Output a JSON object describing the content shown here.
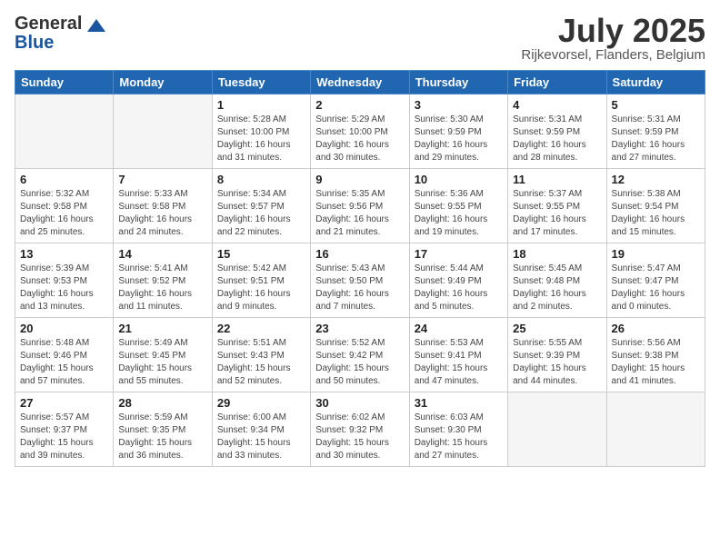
{
  "header": {
    "logo_general": "General",
    "logo_blue": "Blue",
    "month_year": "July 2025",
    "location": "Rijkevorsel, Flanders, Belgium"
  },
  "days_of_week": [
    "Sunday",
    "Monday",
    "Tuesday",
    "Wednesday",
    "Thursday",
    "Friday",
    "Saturday"
  ],
  "weeks": [
    [
      {
        "day": "",
        "empty": true
      },
      {
        "day": "",
        "empty": true
      },
      {
        "day": "1",
        "sunrise": "5:28 AM",
        "sunset": "10:00 PM",
        "daylight": "16 hours and 31 minutes."
      },
      {
        "day": "2",
        "sunrise": "5:29 AM",
        "sunset": "10:00 PM",
        "daylight": "16 hours and 30 minutes."
      },
      {
        "day": "3",
        "sunrise": "5:30 AM",
        "sunset": "9:59 PM",
        "daylight": "16 hours and 29 minutes."
      },
      {
        "day": "4",
        "sunrise": "5:31 AM",
        "sunset": "9:59 PM",
        "daylight": "16 hours and 28 minutes."
      },
      {
        "day": "5",
        "sunrise": "5:31 AM",
        "sunset": "9:59 PM",
        "daylight": "16 hours and 27 minutes."
      }
    ],
    [
      {
        "day": "6",
        "sunrise": "5:32 AM",
        "sunset": "9:58 PM",
        "daylight": "16 hours and 25 minutes."
      },
      {
        "day": "7",
        "sunrise": "5:33 AM",
        "sunset": "9:58 PM",
        "daylight": "16 hours and 24 minutes."
      },
      {
        "day": "8",
        "sunrise": "5:34 AM",
        "sunset": "9:57 PM",
        "daylight": "16 hours and 22 minutes."
      },
      {
        "day": "9",
        "sunrise": "5:35 AM",
        "sunset": "9:56 PM",
        "daylight": "16 hours and 21 minutes."
      },
      {
        "day": "10",
        "sunrise": "5:36 AM",
        "sunset": "9:55 PM",
        "daylight": "16 hours and 19 minutes."
      },
      {
        "day": "11",
        "sunrise": "5:37 AM",
        "sunset": "9:55 PM",
        "daylight": "16 hours and 17 minutes."
      },
      {
        "day": "12",
        "sunrise": "5:38 AM",
        "sunset": "9:54 PM",
        "daylight": "16 hours and 15 minutes."
      }
    ],
    [
      {
        "day": "13",
        "sunrise": "5:39 AM",
        "sunset": "9:53 PM",
        "daylight": "16 hours and 13 minutes."
      },
      {
        "day": "14",
        "sunrise": "5:41 AM",
        "sunset": "9:52 PM",
        "daylight": "16 hours and 11 minutes."
      },
      {
        "day": "15",
        "sunrise": "5:42 AM",
        "sunset": "9:51 PM",
        "daylight": "16 hours and 9 minutes."
      },
      {
        "day": "16",
        "sunrise": "5:43 AM",
        "sunset": "9:50 PM",
        "daylight": "16 hours and 7 minutes."
      },
      {
        "day": "17",
        "sunrise": "5:44 AM",
        "sunset": "9:49 PM",
        "daylight": "16 hours and 5 minutes."
      },
      {
        "day": "18",
        "sunrise": "5:45 AM",
        "sunset": "9:48 PM",
        "daylight": "16 hours and 2 minutes."
      },
      {
        "day": "19",
        "sunrise": "5:47 AM",
        "sunset": "9:47 PM",
        "daylight": "16 hours and 0 minutes."
      }
    ],
    [
      {
        "day": "20",
        "sunrise": "5:48 AM",
        "sunset": "9:46 PM",
        "daylight": "15 hours and 57 minutes."
      },
      {
        "day": "21",
        "sunrise": "5:49 AM",
        "sunset": "9:45 PM",
        "daylight": "15 hours and 55 minutes."
      },
      {
        "day": "22",
        "sunrise": "5:51 AM",
        "sunset": "9:43 PM",
        "daylight": "15 hours and 52 minutes."
      },
      {
        "day": "23",
        "sunrise": "5:52 AM",
        "sunset": "9:42 PM",
        "daylight": "15 hours and 50 minutes."
      },
      {
        "day": "24",
        "sunrise": "5:53 AM",
        "sunset": "9:41 PM",
        "daylight": "15 hours and 47 minutes."
      },
      {
        "day": "25",
        "sunrise": "5:55 AM",
        "sunset": "9:39 PM",
        "daylight": "15 hours and 44 minutes."
      },
      {
        "day": "26",
        "sunrise": "5:56 AM",
        "sunset": "9:38 PM",
        "daylight": "15 hours and 41 minutes."
      }
    ],
    [
      {
        "day": "27",
        "sunrise": "5:57 AM",
        "sunset": "9:37 PM",
        "daylight": "15 hours and 39 minutes."
      },
      {
        "day": "28",
        "sunrise": "5:59 AM",
        "sunset": "9:35 PM",
        "daylight": "15 hours and 36 minutes."
      },
      {
        "day": "29",
        "sunrise": "6:00 AM",
        "sunset": "9:34 PM",
        "daylight": "15 hours and 33 minutes."
      },
      {
        "day": "30",
        "sunrise": "6:02 AM",
        "sunset": "9:32 PM",
        "daylight": "15 hours and 30 minutes."
      },
      {
        "day": "31",
        "sunrise": "6:03 AM",
        "sunset": "9:30 PM",
        "daylight": "15 hours and 27 minutes."
      },
      {
        "day": "",
        "empty": true
      },
      {
        "day": "",
        "empty": true
      }
    ]
  ],
  "labels": {
    "sunrise_prefix": "Sunrise: ",
    "sunset_prefix": "Sunset: ",
    "daylight_prefix": "Daylight: "
  }
}
